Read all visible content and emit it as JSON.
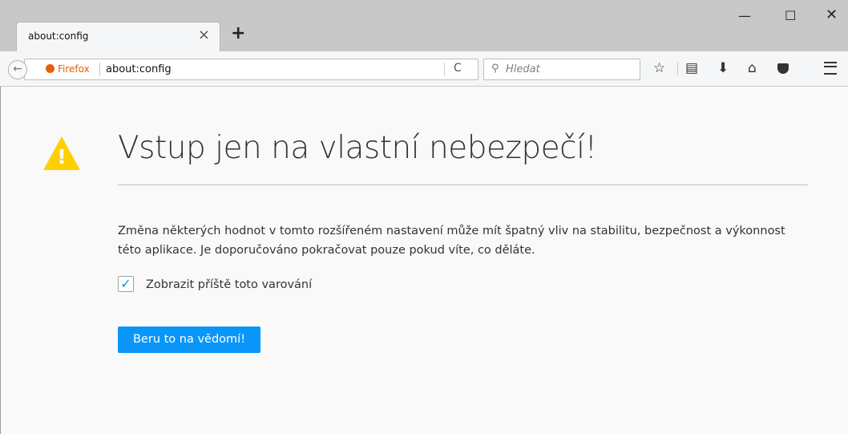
{
  "tab": {
    "title": "about:config",
    "close_glyph": "×",
    "newtab_glyph": "+"
  },
  "window_controls": {
    "minimize": "—",
    "maximize": "☐",
    "close": "✕"
  },
  "toolbar": {
    "identity_label": "Firefox",
    "url": "about:config",
    "reload_glyph": "C",
    "search_icon": "⚲",
    "search_placeholder": "Hledat",
    "icons": [
      "back-icon",
      "reload-icon",
      "search-icon",
      "bookmark-star-icon",
      "reading-list-icon",
      "download-icon",
      "home-icon",
      "pocket-icon",
      "menu-icon"
    ]
  },
  "page": {
    "warning_icon": "!",
    "heading": "Vstup jen na vlastní nebezpečí!",
    "description": "Změna některých hodnot v tomto rozšířeném nastavení může mít špatný vliv na stabilitu, bezpečnost a výkonnost této aplikace. Je doporučováno pokračovat pouze pokud víte, co děláte.",
    "checkbox_checked": true,
    "checkbox_glyph": "✓",
    "checkbox_label": "Zobrazit příště toto varování",
    "accept_button": "Beru to na vědomí!"
  },
  "colors": {
    "accent": "#0996f8",
    "warning": "#ffcf00",
    "identity": "#e66000"
  }
}
